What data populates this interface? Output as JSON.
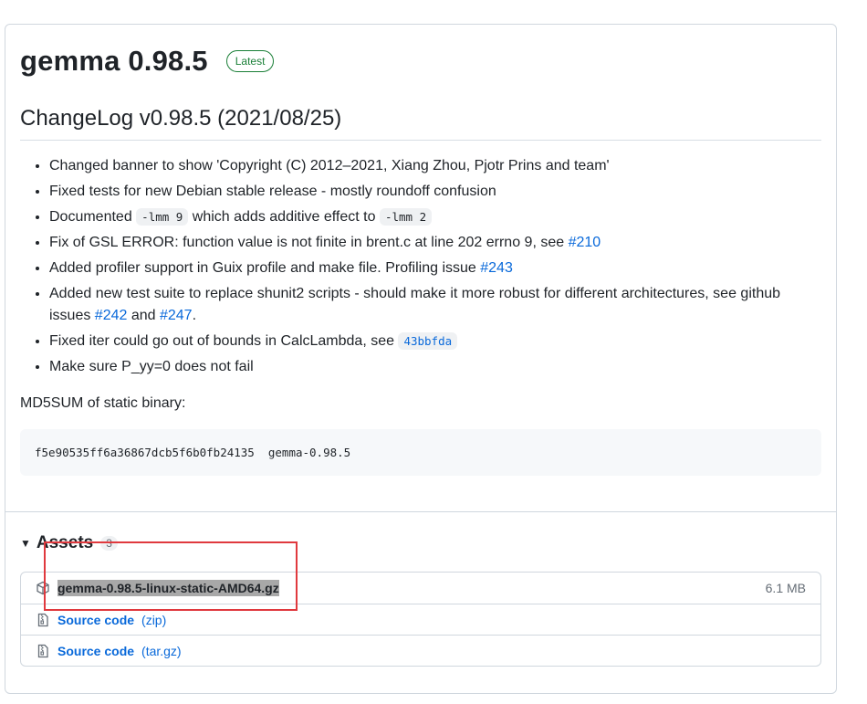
{
  "release": {
    "title": "gemma 0.98.5",
    "badge": "Latest",
    "changelog_heading": "ChangeLog v0.98.5 (2021/08/25)",
    "changes": {
      "c1": "Changed banner to show 'Copyright (C) 2012–2021, Xiang Zhou, Pjotr Prins and team'",
      "c2": "Fixed tests for new Debian stable release - mostly roundoff confusion",
      "c3_pre": "Documented ",
      "c3_code1": "-lmm 9",
      "c3_mid": " which adds additive effect to ",
      "c3_code2": "-lmm 2",
      "c4_pre": "Fix of GSL ERROR: function value is not finite in brent.c at line 202 errno 9, see ",
      "c4_link": "#210",
      "c5_pre": "Added profiler support in Guix profile and make file. Profiling issue ",
      "c5_link": "#243",
      "c6_pre": "Added new test suite to replace shunit2 scripts - should make it more robust for different architectures, see github issues ",
      "c6_link1": "#242",
      "c6_mid": " and ",
      "c6_link2": "#247",
      "c6_post": ".",
      "c7_pre": "Fixed iter could go out of bounds in CalcLambda, see ",
      "c7_code": "43bbfda",
      "c8": "Make sure P_yy=0 does not fail"
    },
    "md5_label": "MD5SUM of static binary:",
    "md5_value": "f5e90535ff6a36867dcb5f6b0fb24135  gemma-0.98.5"
  },
  "assets": {
    "title": "Assets",
    "count": "3",
    "items": [
      {
        "name": "gemma-0.98.5-linux-static-AMD64.gz",
        "size": "6.1 MB",
        "icon": "package-icon"
      },
      {
        "label": "Source code",
        "format": "(zip)",
        "icon": "file-zip-icon"
      },
      {
        "label": "Source code",
        "format": "(tar.gz)",
        "icon": "file-zip-icon"
      }
    ]
  },
  "colors": {
    "link": "#0969da",
    "badge_green": "#1a7f37",
    "highlight_box": "#e0393e",
    "selection": "#a8a8a8"
  }
}
